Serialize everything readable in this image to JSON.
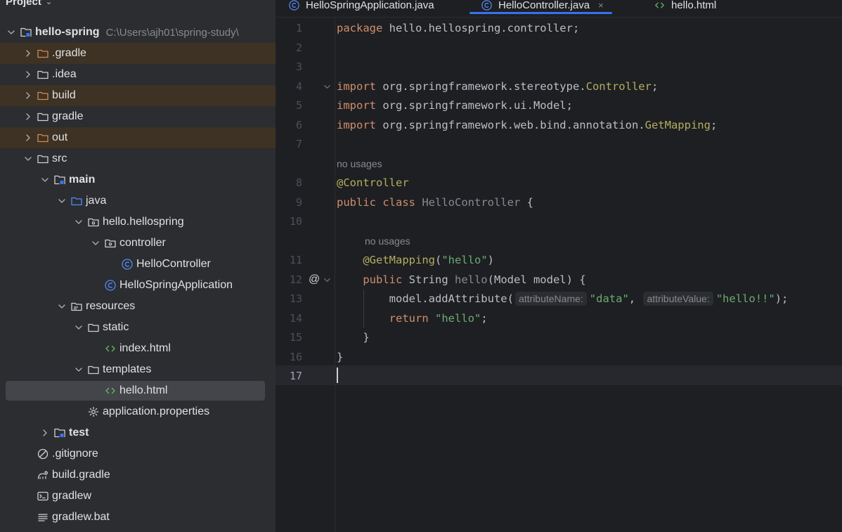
{
  "project_panel": {
    "title": "Project",
    "tree": [
      {
        "label": "hello-spring",
        "path": "C:\\Users\\ajh01\\spring-study\\",
        "icon": "module-folder-icon",
        "arrow": "down",
        "indent": 0,
        "bold": true
      },
      {
        "label": ".gradle",
        "icon": "folder-icon",
        "arrow": "right",
        "indent": 1,
        "excluded": true
      },
      {
        "label": ".idea",
        "icon": "folder-icon",
        "arrow": "right",
        "indent": 1
      },
      {
        "label": "build",
        "icon": "folder-icon",
        "arrow": "right",
        "indent": 1,
        "excluded": true
      },
      {
        "label": "gradle",
        "icon": "folder-icon",
        "arrow": "right",
        "indent": 1
      },
      {
        "label": "out",
        "icon": "folder-icon",
        "arrow": "right",
        "indent": 1,
        "excluded": true
      },
      {
        "label": "src",
        "icon": "folder-icon",
        "arrow": "down",
        "indent": 1
      },
      {
        "label": "main",
        "icon": "module-folder-icon",
        "arrow": "down",
        "indent": 2,
        "bold": true
      },
      {
        "label": "java",
        "icon": "source-folder-icon",
        "arrow": "down",
        "indent": 3
      },
      {
        "label": "hello.hellospring",
        "icon": "package-icon",
        "arrow": "down",
        "indent": 4
      },
      {
        "label": "controller",
        "icon": "package-icon",
        "arrow": "down",
        "indent": 5
      },
      {
        "label": "HelloController",
        "icon": "class-icon",
        "arrow": "none",
        "indent": 6
      },
      {
        "label": "HelloSpringApplication",
        "icon": "class-icon",
        "arrow": "none",
        "indent": 5
      },
      {
        "label": "resources",
        "icon": "resources-folder-icon",
        "arrow": "down",
        "indent": 3
      },
      {
        "label": "static",
        "icon": "folder-icon",
        "arrow": "down",
        "indent": 4
      },
      {
        "label": "index.html",
        "icon": "html-file-icon",
        "arrow": "none",
        "indent": 5
      },
      {
        "label": "templates",
        "icon": "folder-icon",
        "arrow": "down",
        "indent": 4
      },
      {
        "label": "hello.html",
        "icon": "html-file-icon",
        "arrow": "none",
        "indent": 5,
        "selected": true
      },
      {
        "label": "application.properties",
        "icon": "settings-file-icon",
        "arrow": "none",
        "indent": 4
      },
      {
        "label": "test",
        "icon": "module-folder-icon",
        "arrow": "right",
        "indent": 2,
        "bold": true
      },
      {
        "label": ".gitignore",
        "icon": "ignore-file-icon",
        "arrow": "none",
        "indent": 1
      },
      {
        "label": "build.gradle",
        "icon": "gradle-file-icon",
        "arrow": "none",
        "indent": 1
      },
      {
        "label": "gradlew",
        "icon": "terminal-file-icon",
        "arrow": "none",
        "indent": 1
      },
      {
        "label": "gradlew.bat",
        "icon": "text-file-icon",
        "arrow": "none",
        "indent": 1
      }
    ]
  },
  "tabs": [
    {
      "label": "HelloSpringApplication.java",
      "icon": "class-icon",
      "active": false
    },
    {
      "label": "HelloController.java",
      "icon": "class-icon",
      "active": true,
      "close": "×"
    },
    {
      "label": "hello.html",
      "icon": "html-file-icon",
      "active": false
    }
  ],
  "editor": {
    "usage_hint": "no usages",
    "gutter_at_marker": "@",
    "lines": [
      {
        "n": "1",
        "tokens": [
          [
            "kw",
            "package"
          ],
          [
            "",
            "hello.hellospring.controller;"
          ]
        ]
      },
      {
        "n": "2",
        "tokens": []
      },
      {
        "n": "3",
        "tokens": []
      },
      {
        "n": "4",
        "fold": true,
        "tokens": [
          [
            "kw",
            "import"
          ],
          [
            "",
            "org.springframework.stereotype."
          ],
          [
            "cls",
            "Controller"
          ],
          [
            "",
            ";"
          ]
        ]
      },
      {
        "n": "5",
        "tokens": [
          [
            "kw",
            "import"
          ],
          [
            "",
            "org.springframework.ui.Model;"
          ]
        ]
      },
      {
        "n": "6",
        "tokens": [
          [
            "kw",
            "import"
          ],
          [
            "",
            "org.springframework.web.bind.annotation."
          ],
          [
            "cls",
            "GetMapping"
          ],
          [
            "",
            ";"
          ]
        ]
      },
      {
        "n": "7",
        "tokens": []
      },
      {
        "n": "8",
        "usage_before": 0,
        "tokens": [
          [
            "ann",
            "@Controller"
          ]
        ]
      },
      {
        "n": "9",
        "tokens": [
          [
            "kw",
            "public class "
          ],
          [
            "dim",
            "HelloController"
          ],
          [
            "",
            " {"
          ]
        ]
      },
      {
        "n": "10",
        "tokens": []
      },
      {
        "n": "11",
        "usage_before": 40,
        "tokens": [
          [
            "",
            "    "
          ],
          [
            "ann",
            "@GetMapping"
          ],
          [
            "",
            "("
          ],
          [
            "str",
            "\"hello\""
          ],
          [
            "",
            ")"
          ]
        ]
      },
      {
        "n": "12",
        "marker": true,
        "fold": true,
        "tokens": [
          [
            "",
            "    "
          ],
          [
            "kw",
            "public "
          ],
          [
            "",
            "String "
          ],
          [
            "dim",
            "hello"
          ],
          [
            "",
            "(Model model) {"
          ]
        ]
      },
      {
        "n": "13",
        "tokens": [
          [
            "",
            "        model.addAttribute("
          ],
          [
            "hint",
            "attributeName:"
          ],
          [
            "str",
            "\"data\""
          ],
          [
            "",
            ", "
          ],
          [
            "hint",
            "attributeValue:"
          ],
          [
            "str",
            "\"hello!!\""
          ],
          [
            "",
            ");"
          ]
        ]
      },
      {
        "n": "14",
        "tokens": [
          [
            "",
            "        "
          ],
          [
            "kw",
            "return "
          ],
          [
            "str",
            "\"hello\""
          ],
          [
            "",
            ";"
          ]
        ]
      },
      {
        "n": "15",
        "tokens": [
          [
            "",
            "    }"
          ]
        ]
      },
      {
        "n": "16",
        "tokens": [
          [
            "",
            "}"
          ]
        ]
      },
      {
        "n": "17",
        "current": true,
        "tokens": []
      }
    ]
  },
  "colors": {
    "panel_bg": "#2b2d30",
    "editor_bg": "#1e1f22",
    "excluded_row_bg": "#3d3223",
    "selection_bg": "#43454a",
    "accent": "#3574f0",
    "keyword": "#cf8e6d",
    "string": "#6aab73",
    "annotation": "#b3ae60"
  }
}
